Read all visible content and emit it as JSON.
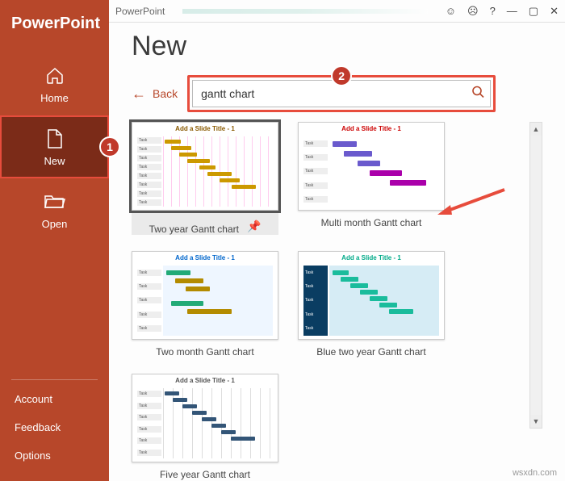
{
  "app_name": "PowerPoint",
  "titlebar": {
    "title": "PowerPoint"
  },
  "sidebar": {
    "brand": "PowerPoint",
    "items": [
      {
        "label": "Home"
      },
      {
        "label": "New"
      },
      {
        "label": "Open"
      }
    ],
    "footer": [
      {
        "label": "Account"
      },
      {
        "label": "Feedback"
      },
      {
        "label": "Options"
      }
    ]
  },
  "page": {
    "title": "New",
    "back_label": "Back",
    "search_value": "gantt chart"
  },
  "callouts": {
    "one": "1",
    "two": "2"
  },
  "templates": [
    {
      "name": "Two year Gantt chart",
      "slide_title": "Add a Slide Title - 1",
      "selected": true
    },
    {
      "name": "Multi month Gantt chart",
      "slide_title": "Add a Slide Title - 1",
      "selected": false
    },
    {
      "name": "Two month Gantt chart",
      "slide_title": "Add a Slide Title - 1",
      "selected": false
    },
    {
      "name": "Blue two year Gantt chart",
      "slide_title": "Add a Slide Title - 1",
      "selected": false
    },
    {
      "name": "Five year Gantt chart",
      "slide_title": "Add a Slide Title - 1",
      "selected": false
    }
  ],
  "watermark": "wsxdn.com"
}
